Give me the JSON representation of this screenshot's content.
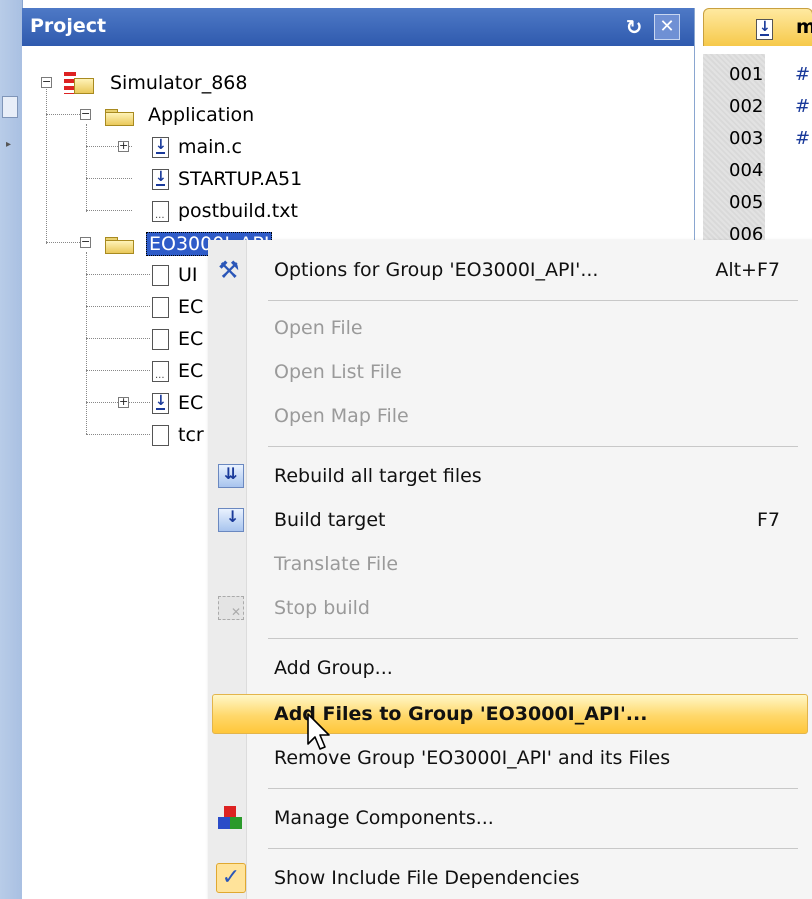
{
  "panel": {
    "title": "Project",
    "pin_glyph": "↻",
    "close_glyph": "✕"
  },
  "tree": {
    "root": {
      "label": "Simulator_868",
      "icon": "project-icon"
    },
    "groups": [
      {
        "label": "Application",
        "icon": "folder-icon",
        "files": [
          {
            "label": "main.c",
            "icon": "c-file-icon",
            "expandable": true
          },
          {
            "label": "STARTUP.A51",
            "icon": "c-file-icon",
            "expandable": false
          },
          {
            "label": "postbuild.txt",
            "icon": "text-file-icon",
            "expandable": false
          }
        ]
      },
      {
        "label": "EO3000I_API",
        "icon": "folder-icon",
        "selected": true,
        "files": [
          {
            "label": "UI",
            "icon": "blank-file-icon",
            "expandable": false
          },
          {
            "label": "EC",
            "icon": "blank-file-icon",
            "expandable": false
          },
          {
            "label": "EC",
            "icon": "blank-file-icon",
            "expandable": false
          },
          {
            "label": "EC",
            "icon": "text-file-icon",
            "expandable": false
          },
          {
            "label": "EC",
            "icon": "c-file-icon",
            "expandable": true
          },
          {
            "label": "tcr",
            "icon": "blank-file-icon",
            "expandable": false
          }
        ]
      }
    ]
  },
  "editor": {
    "tab_label": "m",
    "lines": [
      {
        "no": "001",
        "text": "#"
      },
      {
        "no": "002",
        "text": "#"
      },
      {
        "no": "003",
        "text": "#"
      },
      {
        "no": "004",
        "text": ""
      },
      {
        "no": "005",
        "text": ""
      },
      {
        "no": "006",
        "text": ""
      }
    ]
  },
  "context_menu": {
    "items": [
      {
        "label": "Options for Group 'EO3000I_API'...",
        "shortcut": "Alt+F7",
        "icon": "options-wand-icon",
        "enabled": true
      },
      {
        "label": "Open File",
        "shortcut": "",
        "icon": "",
        "enabled": false
      },
      {
        "label": "Open List File",
        "shortcut": "",
        "icon": "",
        "enabled": false
      },
      {
        "label": "Open Map File",
        "shortcut": "",
        "icon": "",
        "enabled": false
      },
      {
        "label": "Rebuild all target files",
        "shortcut": "",
        "icon": "rebuild-icon",
        "enabled": true
      },
      {
        "label": "Build target",
        "shortcut": "F7",
        "icon": "build-icon",
        "enabled": true
      },
      {
        "label": "Translate File",
        "shortcut": "",
        "icon": "",
        "enabled": false
      },
      {
        "label": "Stop build",
        "shortcut": "",
        "icon": "stop-build-icon",
        "enabled": false
      },
      {
        "label": "Add Group...",
        "shortcut": "",
        "icon": "",
        "enabled": true
      },
      {
        "label": "Add Files to Group 'EO3000I_API'...",
        "shortcut": "",
        "icon": "",
        "enabled": true,
        "highlighted": true
      },
      {
        "label": "Remove Group 'EO3000I_API' and its Files",
        "shortcut": "",
        "icon": "",
        "enabled": true
      },
      {
        "label": "Manage Components...",
        "shortcut": "",
        "icon": "components-icon",
        "enabled": true
      },
      {
        "label": "Show Include File Dependencies",
        "shortcut": "",
        "icon": "checkmark-icon",
        "enabled": true,
        "checked": true
      }
    ]
  },
  "colors": {
    "header_blue": "#2f5aae",
    "selection_blue": "#2e5bc8",
    "highlight_orange": "#ffc73a",
    "disabled_text": "#9a9a9a"
  }
}
